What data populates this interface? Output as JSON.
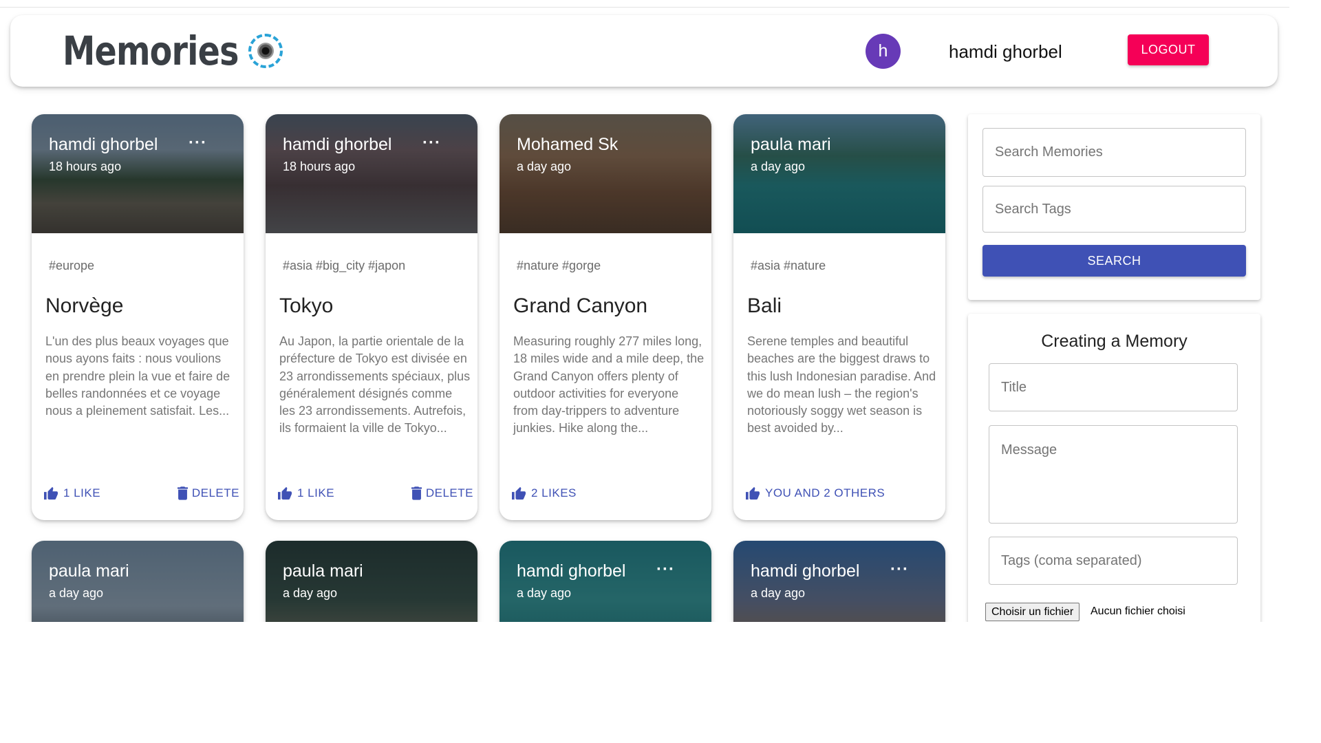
{
  "header": {
    "brand": "Memories",
    "avatar_initial": "h",
    "username": "hamdi ghorbel",
    "logout_label": "LOGOUT"
  },
  "posts": [
    {
      "author": "hamdi ghorbel",
      "time": "18 hours ago",
      "more": "···",
      "tags": "#europe",
      "title": "Norvège",
      "message": "L'un des plus beaux voyages que nous ayons faits : nous voulions en prendre plein la vue et faire de belles randonnées et ce voyage nous a pleinement satisfait. Les...",
      "likes": "1 LIKE",
      "delete": "DELETE"
    },
    {
      "author": "hamdi ghorbel",
      "time": "18 hours ago",
      "more": "···",
      "tags": "#asia #big_city #japon",
      "title": "Tokyo",
      "message": "Au Japon, la partie orientale de la préfecture de Tokyo est divisée en 23 arrondissements spéciaux, plus généralement désignés comme les 23 arrondissements. Autrefois, ils formaient la ville de Tokyo...",
      "likes": "1 LIKE",
      "delete": "DELETE"
    },
    {
      "author": "Mohamed Sk",
      "time": "a day ago",
      "tags": "#nature #gorge",
      "title": "Grand Canyon",
      "message": "Measuring roughly 277 miles long, 18 miles wide and a mile deep, the Grand Canyon offers plenty of outdoor activities for everyone from day-trippers to adventure junkies. Hike along the...",
      "likes": "2 LIKES"
    },
    {
      "author": "paula mari",
      "time": "a day ago",
      "tags": "#asia #nature",
      "title": "Bali",
      "message": "Serene temples and beautiful beaches are the biggest draws to this lush Indonesian paradise. And we do mean lush – the region's notoriously soggy wet season is best avoided by...",
      "likes": "YOU AND 2 OTHERS"
    },
    {
      "author": "paula mari",
      "time": "a day ago"
    },
    {
      "author": "paula mari",
      "time": "a day ago"
    },
    {
      "author": "hamdi ghorbel",
      "time": "a day ago",
      "more": "···"
    },
    {
      "author": "hamdi ghorbel",
      "time": "a day ago",
      "more": "···"
    }
  ],
  "search": {
    "memories_placeholder": "Search Memories",
    "tags_placeholder": "Search Tags",
    "button_label": "SEARCH"
  },
  "form": {
    "title": "Creating a Memory",
    "title_placeholder": "Title",
    "message_placeholder": "Message",
    "tags_placeholder": "Tags (coma separated)",
    "file_button": "Choisir un fichier",
    "file_status": "Aucun fichier choisi"
  },
  "colors": {
    "primary": "#3f51b5",
    "secondary": "#f50057",
    "avatar": "#673ab7"
  }
}
